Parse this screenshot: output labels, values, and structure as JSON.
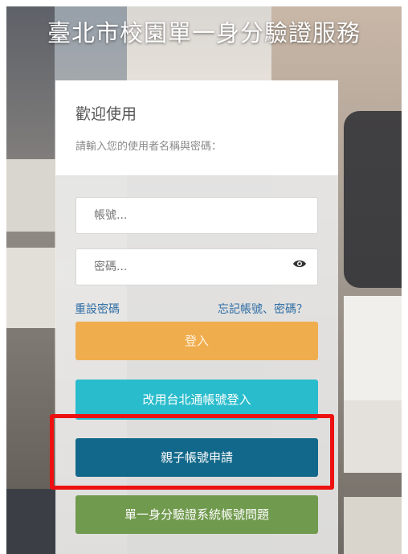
{
  "page": {
    "title": "臺北市校園單一身分驗證服務"
  },
  "login_card": {
    "welcome": "歡迎使用",
    "hint": "請輸入您的使用者名稱與密碼："
  },
  "form": {
    "username_placeholder": "帳號...",
    "password_placeholder": "密碼...",
    "show_password_icon": "eye-icon"
  },
  "links": {
    "reset_password": "重設密碼",
    "forgot_account": "忘記帳號、密碼？"
  },
  "buttons": {
    "login": "登入",
    "taipeipass_login": "改用台北通帳號登入",
    "parent_account": "親子帳號申請",
    "account_problem": "單一身分驗證系統帳號問題"
  },
  "colors": {
    "login": "#f0ad4e",
    "taipeipass": "#29bccc",
    "parent": "#11688a",
    "problem": "#709a4d",
    "highlight": "#ee1111"
  }
}
